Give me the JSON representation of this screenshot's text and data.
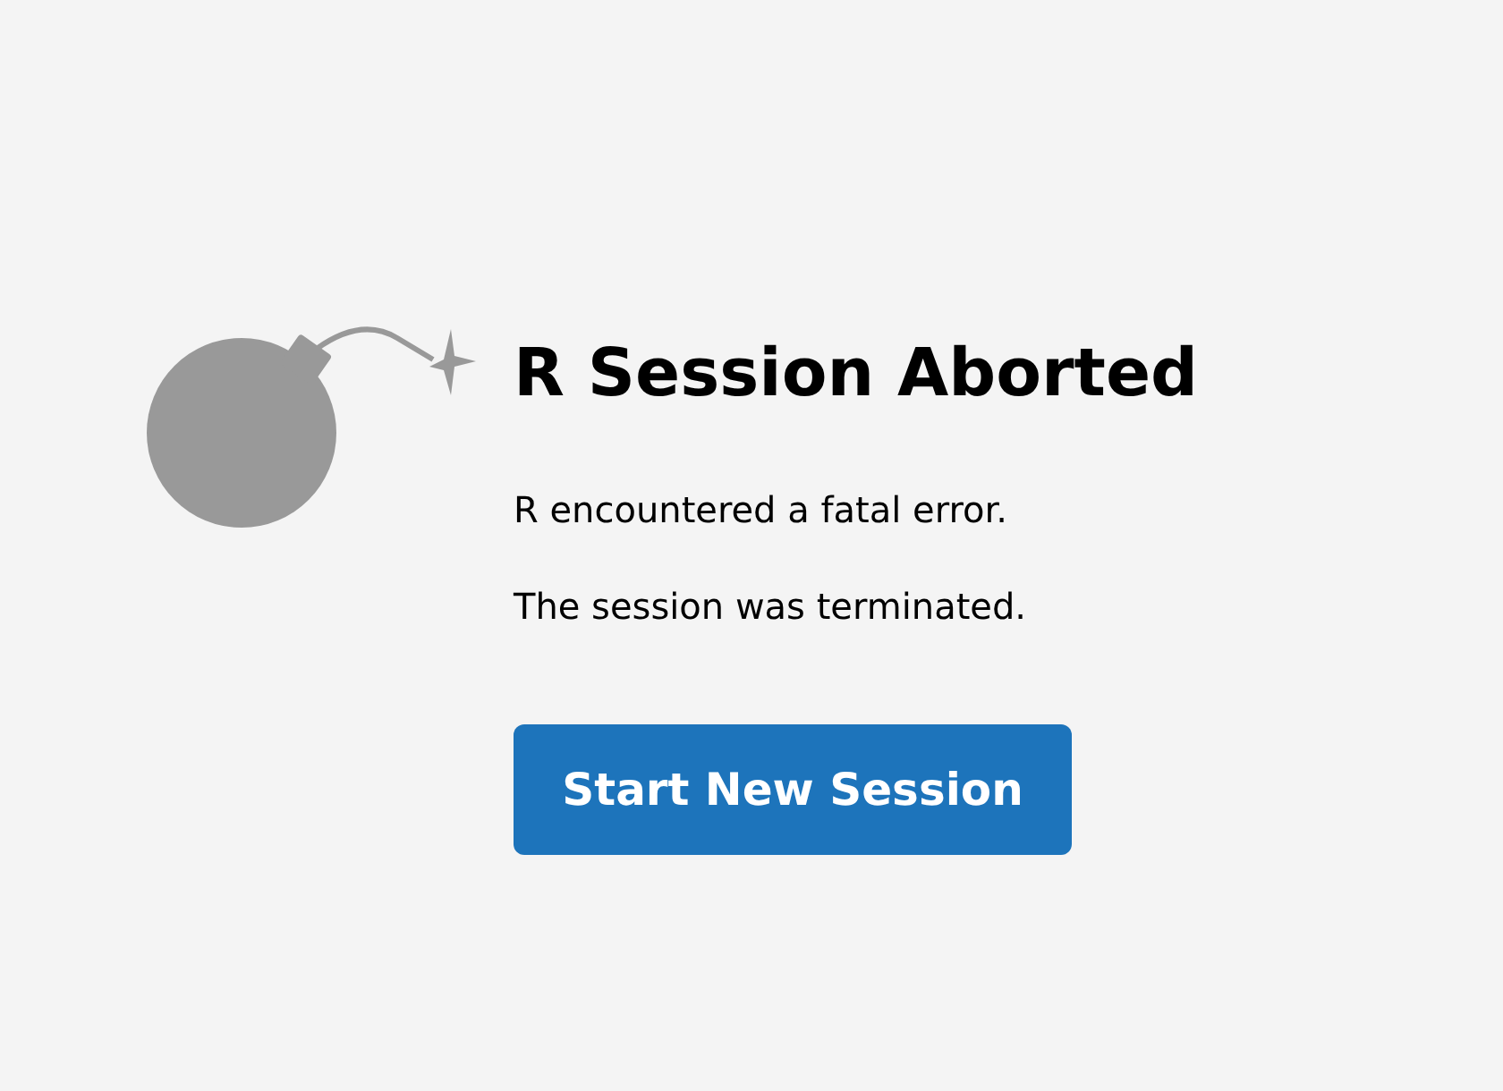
{
  "title": "R Session Aborted",
  "messages": [
    "R encountered a fatal error.",
    "The session was terminated."
  ],
  "button": "Start New Session"
}
